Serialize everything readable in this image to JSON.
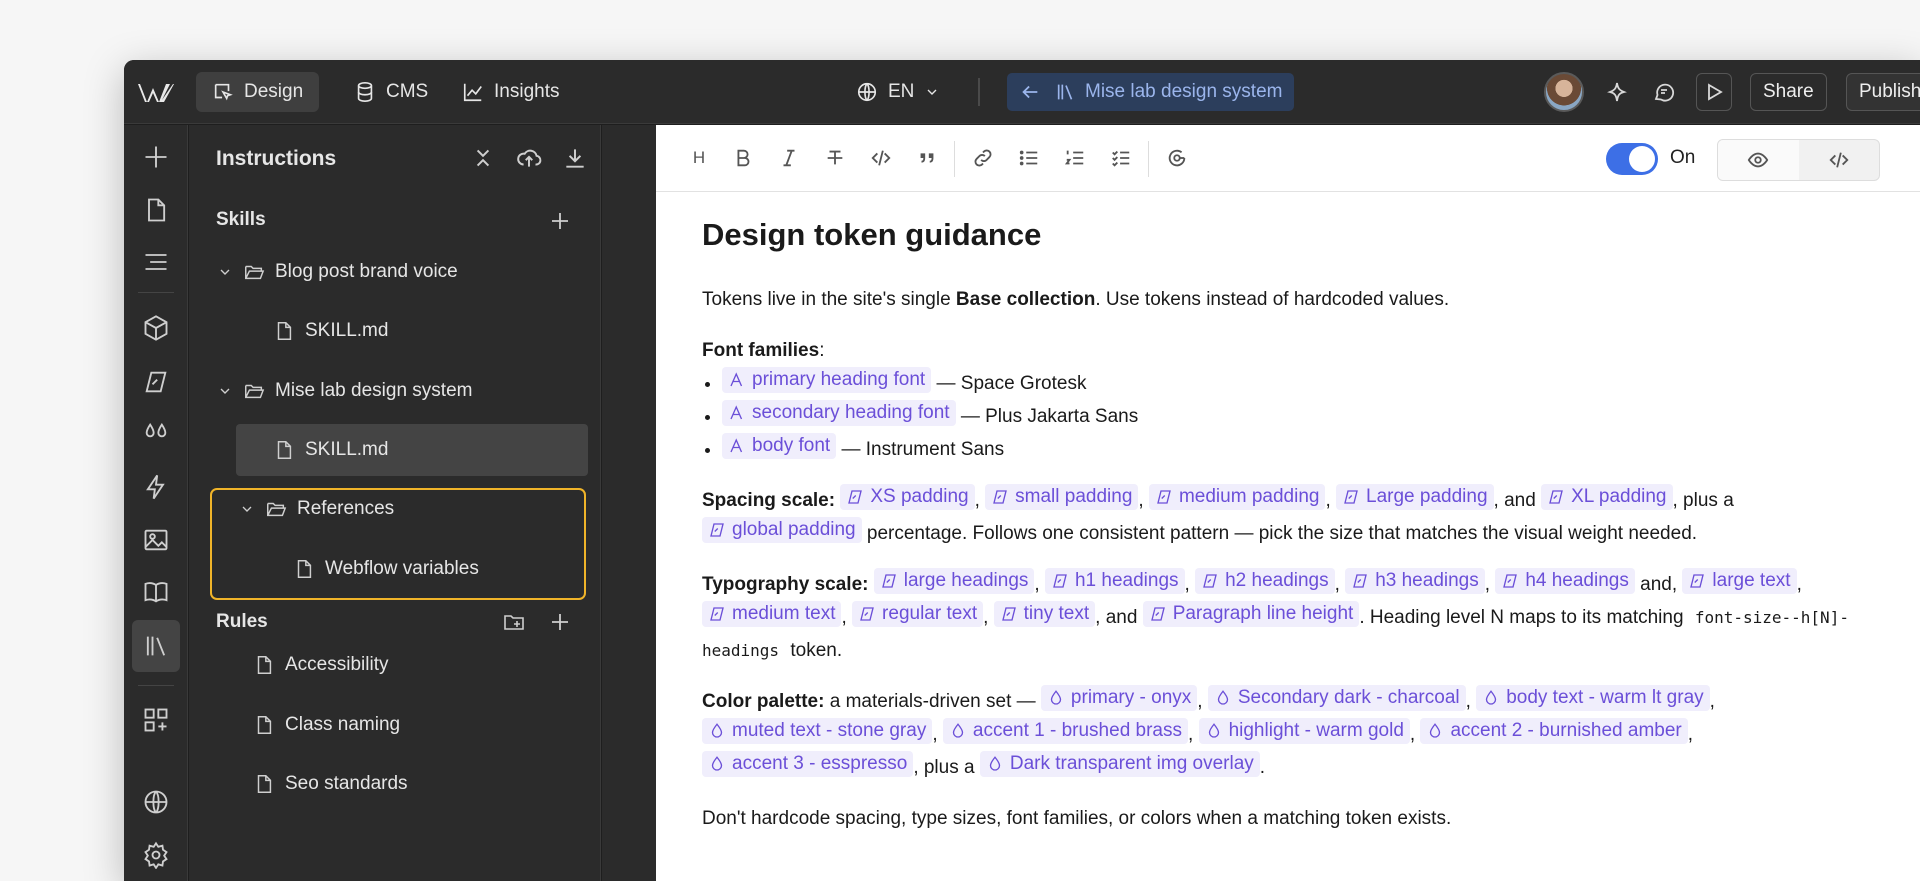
{
  "topbar": {
    "tabs": [
      {
        "label": "Design"
      },
      {
        "label": "CMS"
      },
      {
        "label": "Insights"
      }
    ],
    "language": "EN",
    "breadcrumb": "Mise lab design system",
    "share": "Share",
    "publish": "Publish"
  },
  "panel": {
    "title": "Instructions",
    "skills": {
      "title": "Skills",
      "items": [
        {
          "label": "Blog post brand voice"
        },
        {
          "label": "SKILL.md"
        },
        {
          "label": "Mise lab design system"
        },
        {
          "label": "SKILL.md"
        },
        {
          "label": "References"
        },
        {
          "label": "Webflow variables"
        }
      ]
    },
    "rules": {
      "title": "Rules",
      "items": [
        {
          "label": "Accessibility"
        },
        {
          "label": "Class naming"
        },
        {
          "label": "Seo standards"
        }
      ]
    }
  },
  "editor": {
    "toolbar": {
      "heading_label": "H",
      "toggle_label": "On",
      "toggle_on": true
    },
    "doc": {
      "title": "Design token guidance",
      "intro": {
        "a": "Tokens live in the site's single ",
        "b": "Base collection",
        "c": ". Use tokens instead of hardcoded values."
      },
      "fonts": {
        "label": "Font families",
        "colon": ":",
        "items": [
          {
            "token": "primary heading font",
            "value": " — Space Grotesk"
          },
          {
            "token": "secondary heading font",
            "value": " — Plus Jakarta Sans"
          },
          {
            "token": "body font",
            "value": " — Instrument Sans"
          }
        ]
      },
      "spacing": {
        "label": "Spacing scale:",
        "tokens": [
          "XS padding",
          "small padding",
          "medium padding",
          "Large padding",
          "XL padding",
          "global padding"
        ],
        "and": ", and",
        "plus": ", plus a",
        "tail": " percentage. Follows one consistent pattern — pick the size that matches the visual weight needed."
      },
      "typography": {
        "label": "Typography scale:",
        "tokens": [
          "large headings",
          "h1 headings",
          "h2 headings",
          "h3 headings",
          "h4 headings",
          "large text",
          "medium text",
          "regular text",
          "tiny text",
          "Paragraph line height"
        ],
        "and1": " and,",
        "and2": ", and",
        "tail1": ". Heading level N maps to its matching",
        "code": "font-size--h[N]-headings",
        "tail2": "token."
      },
      "colors": {
        "label": "Color palette:",
        "intro": " a materials-driven set —",
        "tokens": [
          "primary - onyx",
          "Secondary dark - charcoal",
          "body text - warm lt gray",
          "muted text - stone gray",
          "accent 1 - brushed brass",
          "highlight - warm gold",
          "accent 2 - burnished amber",
          "accent 3 - esspresso",
          "Dark transparent img overlay"
        ],
        "plus": ", plus a",
        "end": "."
      },
      "closing": "Don't hardcode spacing, type sizes, font families, or colors when a matching token exists."
    }
  }
}
